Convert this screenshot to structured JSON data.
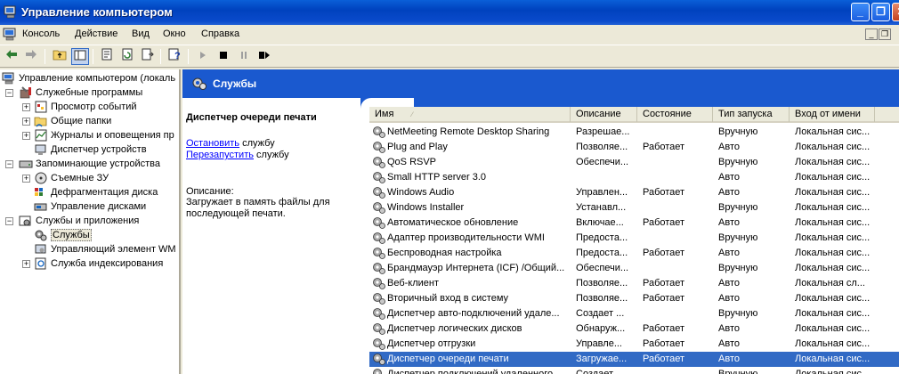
{
  "window": {
    "title": "Управление компьютером",
    "min_label": "_",
    "max_label": "❐",
    "close_label": "✕"
  },
  "menu": {
    "items": [
      "Консоль",
      "Действие",
      "Вид",
      "Окно",
      "Справка"
    ]
  },
  "mdi": {
    "min_label": "_",
    "restore_label": "❐"
  },
  "toolbar": {
    "icons": [
      "back-arrow-icon",
      "forward-arrow-icon",
      "up-folder-icon",
      "show-tree-icon",
      "properties-icon",
      "refresh-icon",
      "export-list-icon",
      "help-icon",
      "play-icon",
      "stop-icon",
      "pause-icon",
      "restart-icon"
    ]
  },
  "tree": {
    "root": "Управление компьютером (локаль",
    "system_tools": "Служебные программы",
    "event_viewer": "Просмотр событий",
    "shared_folders": "Общие папки",
    "logs_alerts": "Журналы и оповещения пр",
    "device_manager": "Диспетчер устройств",
    "storage": "Запоминающие устройства",
    "removable": "Съемные ЗУ",
    "defrag": "Дефрагментация диска",
    "disk_mgmt": "Управление дисками",
    "services_apps": "Службы и приложения",
    "services": "Службы",
    "wmi": "Управляющий элемент WM",
    "indexing": "Служба индексирования"
  },
  "pane": {
    "header": "Службы",
    "selected_service": "Диспетчер очереди печати",
    "stop_link": "Остановить",
    "stop_suffix": " службу",
    "restart_link": "Перезапустить",
    "restart_suffix": " службу",
    "desc_label": "Описание:",
    "desc_text": "Загружает в память файлы для последующей печати."
  },
  "list": {
    "columns": [
      "Имя",
      "Описание",
      "Состояние",
      "Тип запуска",
      "Вход от имени"
    ],
    "rows": [
      [
        "NetMeeting Remote Desktop Sharing",
        "Разрешае...",
        "",
        "Вручную",
        "Локальная сис..."
      ],
      [
        "Plug and Play",
        "Позволяе...",
        "Работает",
        "Авто",
        "Локальная сис..."
      ],
      [
        "QoS RSVP",
        "Обеспечи...",
        "",
        "Вручную",
        "Локальная сис..."
      ],
      [
        "Small HTTP server 3.0",
        "",
        "",
        "Авто",
        "Локальная сис..."
      ],
      [
        "Windows Audio",
        "Управлен...",
        "Работает",
        "Авто",
        "Локальная сис..."
      ],
      [
        "Windows Installer",
        "Устанавл...",
        "",
        "Вручную",
        "Локальная сис..."
      ],
      [
        "Автоматическое обновление",
        "Включае...",
        "Работает",
        "Авто",
        "Локальная сис..."
      ],
      [
        "Адаптер производительности WMI",
        "Предоста...",
        "",
        "Вручную",
        "Локальная сис..."
      ],
      [
        "Беспроводная настройка",
        "Предоста...",
        "Работает",
        "Авто",
        "Локальная сис..."
      ],
      [
        "Брандмауэр Интернета (ICF) /Общий...",
        "Обеспечи...",
        "",
        "Вручную",
        "Локальная сис..."
      ],
      [
        "Веб-клиент",
        "Позволяе...",
        "Работает",
        "Авто",
        "Локальная сл..."
      ],
      [
        "Вторичный вход в систему",
        "Позволяе...",
        "Работает",
        "Авто",
        "Локальная сис..."
      ],
      [
        "Диспетчер авто-подключений удале...",
        "Создает ...",
        "",
        "Вручную",
        "Локальная сис..."
      ],
      [
        "Диспетчер логических дисков",
        "Обнаруж...",
        "Работает",
        "Авто",
        "Локальная сис..."
      ],
      [
        "Диспетчер отгрузки",
        "Управле...",
        "Работает",
        "Авто",
        "Локальная сис..."
      ],
      [
        "Диспетчер очереди печати",
        "Загружае...",
        "Работает",
        "Авто",
        "Локальная сис..."
      ],
      [
        "Диспетчер подключений удаленного ...",
        "Создает ...",
        "",
        "Вручную",
        "Локальная сис..."
      ]
    ],
    "selected_index": 15
  }
}
